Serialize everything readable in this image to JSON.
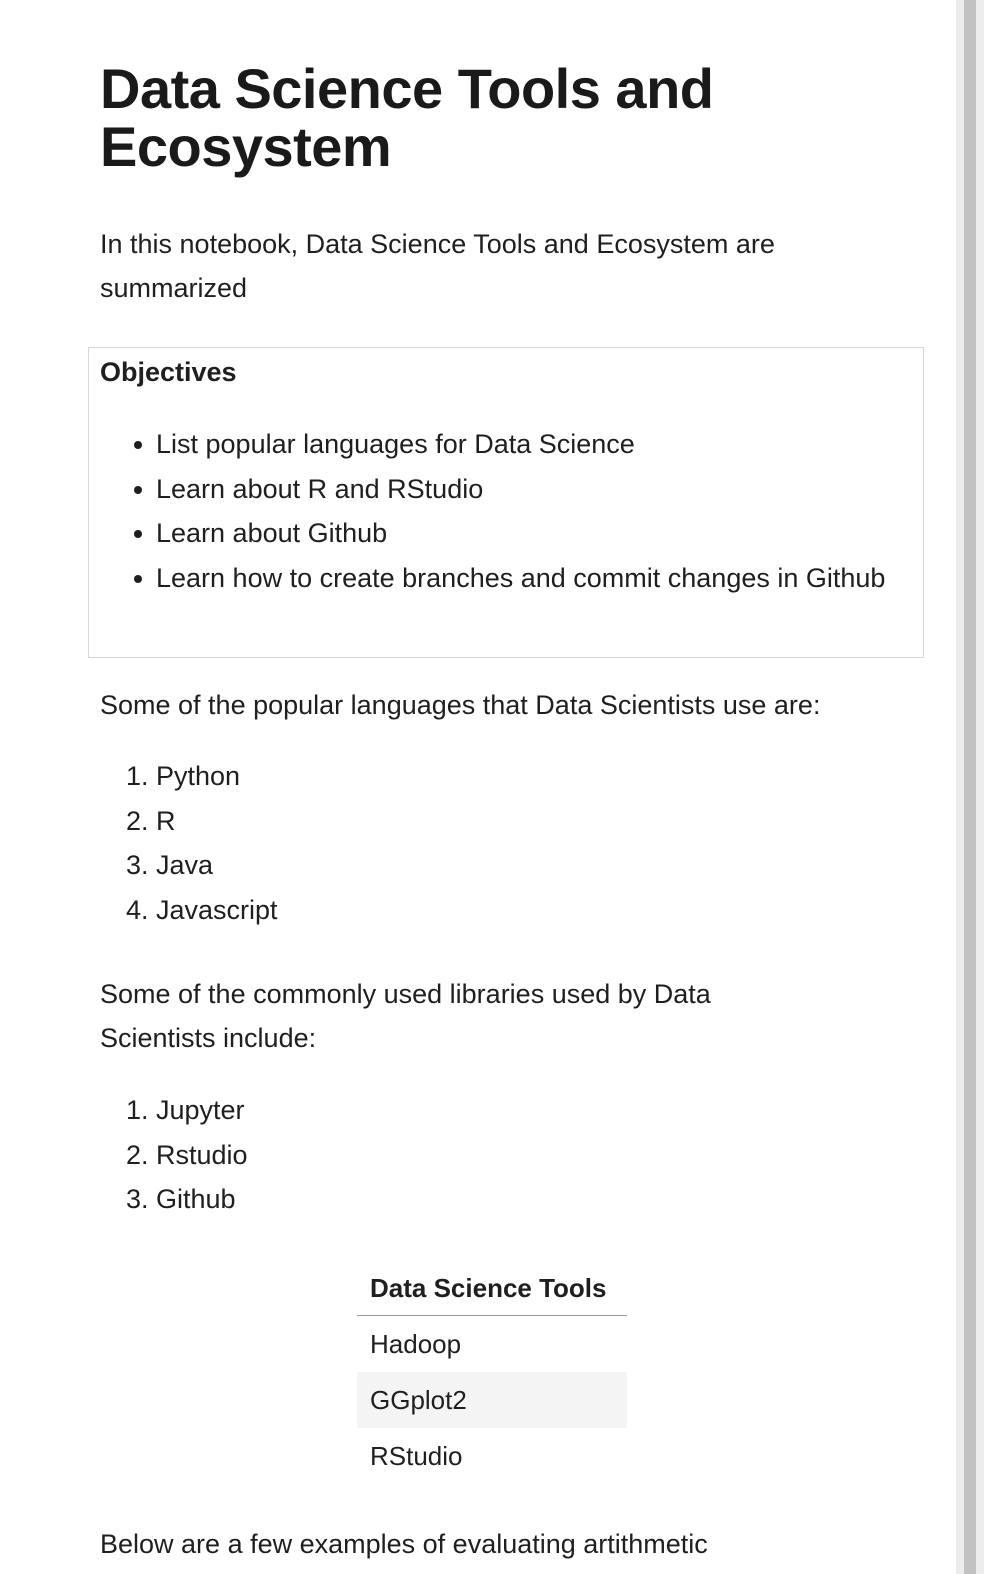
{
  "notebook": {
    "title": "Data Science Tools and Ecosystem",
    "intro": "In this notebook, Data Science Tools and Ecosystem are summarized",
    "objectives": {
      "heading": "Objectives",
      "items": [
        "List popular languages for Data Science",
        "Learn about R and RStudio",
        "Learn about Github",
        "Learn how to create branches and commit changes in Github"
      ]
    },
    "languages": {
      "intro": "Some of the popular languages that Data Scientists use are:",
      "items": [
        "Python",
        "R",
        "Java",
        "Javascript"
      ]
    },
    "libraries": {
      "intro": "Some of the commonly used libraries used by Data Scientists include:",
      "items": [
        "Jupyter",
        "Rstudio",
        "Github"
      ]
    },
    "tools_table": {
      "header": "Data Science Tools",
      "rows": [
        "Hadoop",
        "GGplot2",
        "RStudio"
      ]
    },
    "examples_intro": "Below are a few examples of evaluating artithmetic"
  }
}
